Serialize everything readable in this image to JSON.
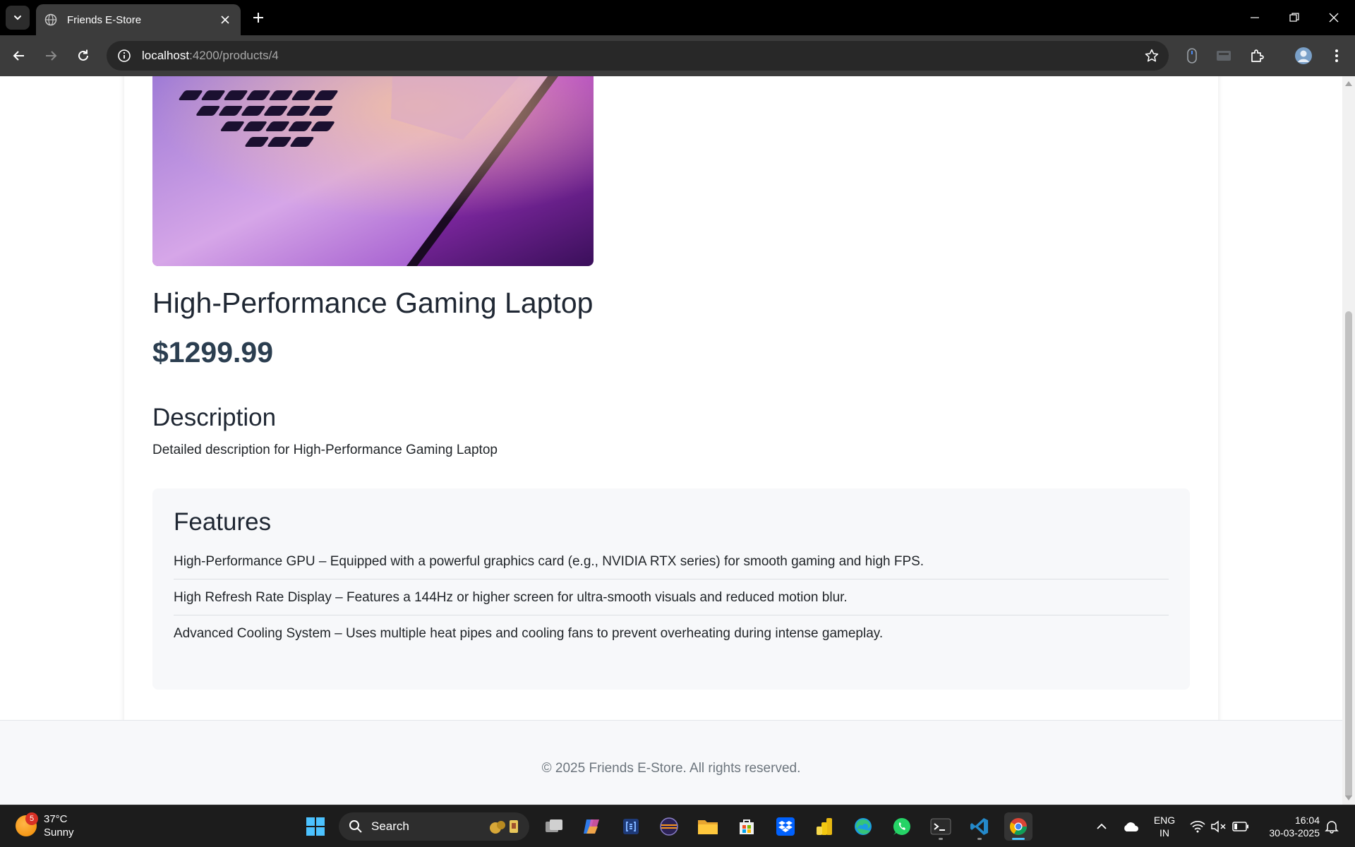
{
  "browser": {
    "tab_title": "Friends E-Store",
    "url_host": "localhost",
    "url_path": ":4200/products/4"
  },
  "product": {
    "title": "High-Performance Gaming Laptop",
    "price": "$1299.99",
    "description_heading": "Description",
    "description": "Detailed description for High-Performance Gaming Laptop",
    "features_heading": "Features",
    "features": [
      "High-Performance GPU – Equipped with a powerful graphics card (e.g., NVIDIA RTX series) for smooth gaming and high FPS.",
      "High Refresh Rate Display – Features a 144Hz or higher screen for ultra-smooth visuals and reduced motion blur.",
      "Advanced Cooling System – Uses multiple heat pipes and cooling fans to prevent overheating during intense gameplay."
    ]
  },
  "footer": {
    "copyright": "© 2025 Friends E-Store. All rights reserved."
  },
  "taskbar": {
    "weather_badge": "5",
    "temperature": "37°C",
    "condition": "Sunny",
    "search_label": "Search",
    "lang_line1": "ENG",
    "lang_line2": "IN",
    "time": "16:04",
    "date": "30-03-2025"
  },
  "colors": {
    "price": "#2b3e50",
    "features_bg": "#f7f8fa",
    "tab_active_bg": "#3c3c3c",
    "taskbar_bg": "#1c1c1c"
  }
}
